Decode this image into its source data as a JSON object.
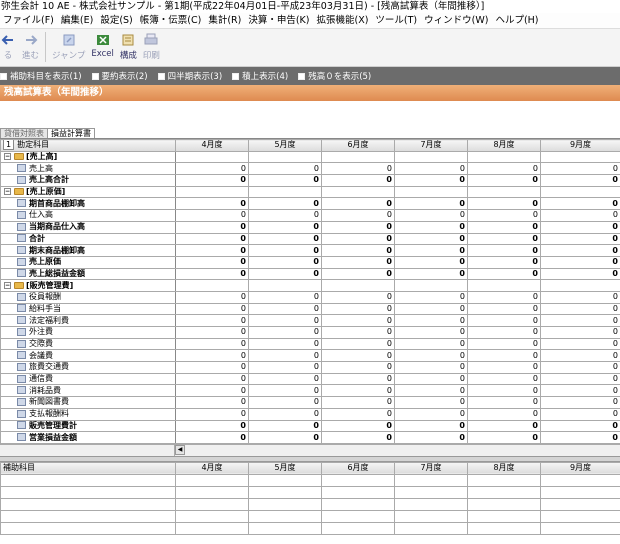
{
  "window": {
    "title": "弥生会計 10 AE - 株式会社サンプル - 第1期(平成22年04月01日-平成23年03月31日) - [残高試算表（年間推移）]"
  },
  "menu": [
    "ファイル(F)",
    "編集(E)",
    "設定(S)",
    "帳簿・伝票(C)",
    "集計(R)",
    "決算・申告(K)",
    "拡張機能(X)",
    "ツール(T)",
    "ウィンドウ(W)",
    "ヘルプ(H)"
  ],
  "toolbar": {
    "back": "る",
    "forward": "進む",
    "jump": "ジャンプ",
    "excel": "Excel",
    "compose": "構成",
    "print": "印刷"
  },
  "options": [
    "補助科目を表示(1)",
    "要約表示(2)",
    "四半期表示(3)",
    "積上表示(4)",
    "残高０を表示(5)"
  ],
  "report_title": "残高試算表（年間推移）",
  "tabs": [
    "貸借対照表",
    "損益計算書"
  ],
  "table": {
    "row_num": "1",
    "account_header": "勘定科目",
    "months": [
      "4月度",
      "5月度",
      "6月度",
      "7月度",
      "8月度",
      "9月度"
    ],
    "rows": [
      {
        "kind": "section",
        "name": "[売上高]"
      },
      {
        "kind": "item",
        "name": "売上高",
        "bold": false,
        "values": [
          "0",
          "0",
          "0",
          "0",
          "0",
          "0"
        ]
      },
      {
        "kind": "item",
        "name": "売上高合計",
        "bold": true,
        "values": [
          "0",
          "0",
          "0",
          "0",
          "0",
          "0"
        ]
      },
      {
        "kind": "section",
        "name": "[売上原価]"
      },
      {
        "kind": "item",
        "name": "期首商品棚卸高",
        "bold": true,
        "values": [
          "0",
          "0",
          "0",
          "0",
          "0",
          "0"
        ]
      },
      {
        "kind": "item",
        "name": "仕入高",
        "bold": false,
        "values": [
          "0",
          "0",
          "0",
          "0",
          "0",
          "0"
        ]
      },
      {
        "kind": "item",
        "name": "当期商品仕入高",
        "bold": true,
        "values": [
          "0",
          "0",
          "0",
          "0",
          "0",
          "0"
        ]
      },
      {
        "kind": "item",
        "name": "合計",
        "bold": true,
        "values": [
          "0",
          "0",
          "0",
          "0",
          "0",
          "0"
        ]
      },
      {
        "kind": "item",
        "name": "期末商品棚卸高",
        "bold": true,
        "values": [
          "0",
          "0",
          "0",
          "0",
          "0",
          "0"
        ]
      },
      {
        "kind": "item",
        "name": "売上原価",
        "bold": true,
        "values": [
          "0",
          "0",
          "0",
          "0",
          "0",
          "0"
        ]
      },
      {
        "kind": "item",
        "name": "売上総損益金額",
        "bold": true,
        "values": [
          "0",
          "0",
          "0",
          "0",
          "0",
          "0"
        ]
      },
      {
        "kind": "section",
        "name": "[販売管理費]"
      },
      {
        "kind": "item",
        "name": "役員報酬",
        "bold": false,
        "values": [
          "0",
          "0",
          "0",
          "0",
          "0",
          "0"
        ]
      },
      {
        "kind": "item",
        "name": "給料手当",
        "bold": false,
        "values": [
          "0",
          "0",
          "0",
          "0",
          "0",
          "0"
        ]
      },
      {
        "kind": "item",
        "name": "法定福利費",
        "bold": false,
        "values": [
          "0",
          "0",
          "0",
          "0",
          "0",
          "0"
        ]
      },
      {
        "kind": "item",
        "name": "外注費",
        "bold": false,
        "values": [
          "0",
          "0",
          "0",
          "0",
          "0",
          "0"
        ]
      },
      {
        "kind": "item",
        "name": "交際費",
        "bold": false,
        "values": [
          "0",
          "0",
          "0",
          "0",
          "0",
          "0"
        ]
      },
      {
        "kind": "item",
        "name": "会議費",
        "bold": false,
        "values": [
          "0",
          "0",
          "0",
          "0",
          "0",
          "0"
        ]
      },
      {
        "kind": "item",
        "name": "旅費交通費",
        "bold": false,
        "values": [
          "0",
          "0",
          "0",
          "0",
          "0",
          "0"
        ]
      },
      {
        "kind": "item",
        "name": "通信費",
        "bold": false,
        "values": [
          "0",
          "0",
          "0",
          "0",
          "0",
          "0"
        ]
      },
      {
        "kind": "item",
        "name": "消耗品費",
        "bold": false,
        "values": [
          "0",
          "0",
          "0",
          "0",
          "0",
          "0"
        ]
      },
      {
        "kind": "item",
        "name": "新聞図書費",
        "bold": false,
        "values": [
          "0",
          "0",
          "0",
          "0",
          "0",
          "0"
        ]
      },
      {
        "kind": "item",
        "name": "支払報酬料",
        "bold": false,
        "values": [
          "0",
          "0",
          "0",
          "0",
          "0",
          "0"
        ]
      },
      {
        "kind": "item",
        "name": "販売管理費計",
        "bold": true,
        "values": [
          "0",
          "0",
          "0",
          "0",
          "0",
          "0"
        ]
      },
      {
        "kind": "item",
        "name": "営業損益金額",
        "bold": true,
        "values": [
          "0",
          "0",
          "0",
          "0",
          "0",
          "0"
        ]
      }
    ]
  },
  "sub_table": {
    "header": "補助科目",
    "months": [
      "4月度",
      "5月度",
      "6月度",
      "7月度",
      "8月度",
      "9月度"
    ],
    "blank_rows": 5
  }
}
